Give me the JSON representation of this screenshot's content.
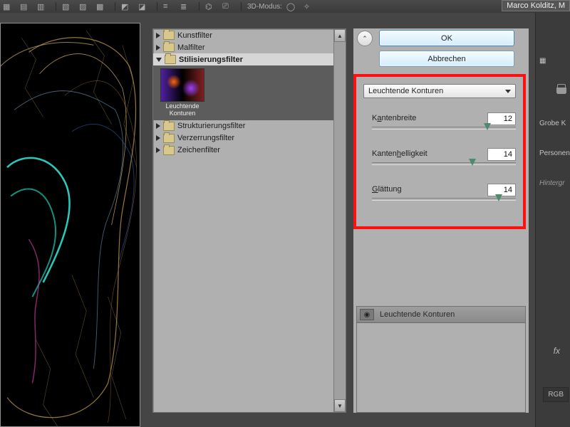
{
  "top_toolbar": {
    "mode_label": "3D-Modus:"
  },
  "window_title_stub": "Marco Kolditz, M",
  "tree": {
    "items": [
      {
        "label": "Kunstfilter",
        "open": false
      },
      {
        "label": "Malfilter",
        "open": false
      },
      {
        "label": "Stilisierungsfilter",
        "open": true
      },
      {
        "label": "Strukturierungsfilter",
        "open": false
      },
      {
        "label": "Verzerrungsfilter",
        "open": false
      },
      {
        "label": "Zeichenfilter",
        "open": false
      }
    ],
    "thumb_label_line1": "Leuchtende",
    "thumb_label_line2": "Konturen"
  },
  "buttons": {
    "ok": "OK",
    "cancel": "Abbrechen"
  },
  "dropdown_selected": "Leuchtende Konturen",
  "params": [
    {
      "label_pre": "K",
      "label_u": "a",
      "label_post": "ntenbreite",
      "value": "12",
      "thumb_pct": 80
    },
    {
      "label_pre": "Kanten",
      "label_u": "h",
      "label_post": "elligkeit",
      "value": "14",
      "thumb_pct": 70
    },
    {
      "label_pre": "",
      "label_u": "G",
      "label_post": "lättung",
      "value": "14",
      "thumb_pct": 88
    }
  ],
  "effects_list_item": "Leuchtende Konturen",
  "right_panel": {
    "row1": "Grobe K",
    "row2": "Personen",
    "row3": "Hintergr",
    "fx": "fx",
    "mode_badge": "RGB"
  }
}
